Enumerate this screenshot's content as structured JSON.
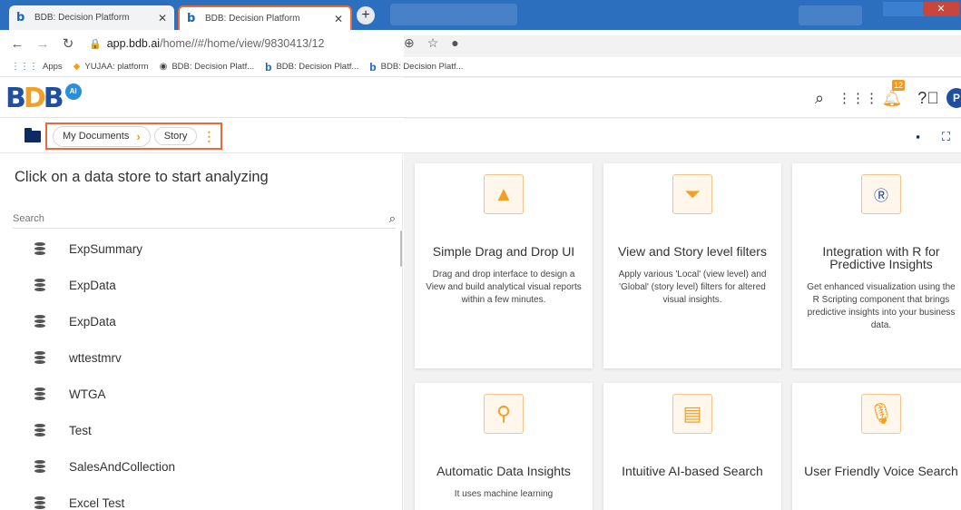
{
  "browser": {
    "tabs": [
      {
        "title": "BDB: Decision Platform",
        "active": false
      },
      {
        "title": "BDB: Decision Platform",
        "active": true
      }
    ],
    "url_host": "app.bdb.ai",
    "url_path": "/home//#/home/view/9830413/12",
    "bookmarks": [
      "Apps",
      "YUJAA: platform",
      "BDB: Decision Platf...",
      "BDB: Decision Platf...",
      "BDB: Decision Platf..."
    ]
  },
  "header": {
    "logo_text_1": "B",
    "logo_text_2": "D",
    "logo_text_3": "B",
    "logo_ai": "AI",
    "notification_count": "12",
    "avatar_initial": "P"
  },
  "breadcrumb": {
    "items": [
      "My Documents",
      "Story"
    ]
  },
  "left_panel": {
    "title": "Click on a data store to start analyzing",
    "search_placeholder": "Search",
    "datastores": [
      "ExpSummary",
      "ExpData",
      "ExpData",
      "wttestmrv",
      "WTGA",
      "Test",
      "SalesAndCollection",
      "Excel Test"
    ]
  },
  "cards": [
    {
      "title": "Simple Drag and Drop UI",
      "desc": "Drag and drop interface to design a View and build analytical visual reports within a few minutes.",
      "icon": "image-icon"
    },
    {
      "title": "View and Story level filters",
      "desc": "Apply various 'Local' (view level) and 'Global' (story level) filters for altered visual insights.",
      "icon": "filter-icon"
    },
    {
      "title": "Integration with R for Predictive Insights",
      "desc": "Get enhanced visualization using the R Scripting component that brings predictive insights into your business data.",
      "icon": "r-script-icon"
    },
    {
      "title": "Automatic Data Insights",
      "desc": "It uses machine learning",
      "icon": "insights-icon"
    },
    {
      "title": "Intuitive AI-based Search",
      "desc": "",
      "icon": "ai-search-icon"
    },
    {
      "title": "User Friendly Voice Search",
      "desc": "",
      "icon": "voice-icon"
    }
  ],
  "colors": {
    "accent": "#f39a1e",
    "brand": "#1e4fa0",
    "highlight": "#e86a3a"
  }
}
